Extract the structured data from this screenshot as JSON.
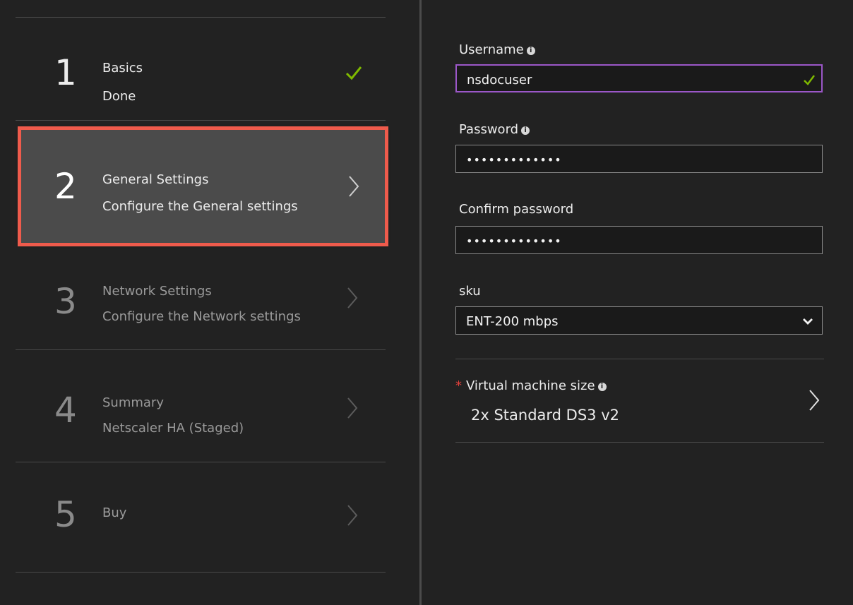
{
  "steps": [
    {
      "number": "1",
      "title": "Basics",
      "subtitle": "Done",
      "state": "done",
      "status_icon": "checkmark-icon"
    },
    {
      "number": "2",
      "title": "General Settings",
      "subtitle": "Configure the General settings",
      "state": "active",
      "status_icon": "chevron-right-icon"
    },
    {
      "number": "3",
      "title": "Network Settings",
      "subtitle": "Configure the Network settings",
      "state": "disabled",
      "status_icon": "chevron-right-icon"
    },
    {
      "number": "4",
      "title": "Summary",
      "subtitle": "Netscaler HA (Staged)",
      "state": "disabled",
      "status_icon": "chevron-right-icon"
    },
    {
      "number": "5",
      "title": "Buy",
      "subtitle": "",
      "state": "disabled",
      "status_icon": "chevron-right-icon"
    }
  ],
  "form": {
    "username": {
      "label": "Username",
      "value": "nsdocuser",
      "valid": true
    },
    "password": {
      "label": "Password",
      "value": "•••••••••••••"
    },
    "confirm_password": {
      "label": "Confirm password",
      "value": "•••••••••••••"
    },
    "sku": {
      "label": "sku",
      "selected": "ENT-200 mbps"
    },
    "vm_size": {
      "label": "Virtual machine size",
      "required_marker": "*",
      "value": "2x Standard DS3 v2"
    }
  },
  "colors": {
    "background": "#222222",
    "active_step_bg": "#4b4b4b",
    "highlight_border": "#ef5b4c",
    "focus_border": "#9b57c8",
    "valid_check": "#7fba00",
    "required_star": "#e2403c"
  }
}
